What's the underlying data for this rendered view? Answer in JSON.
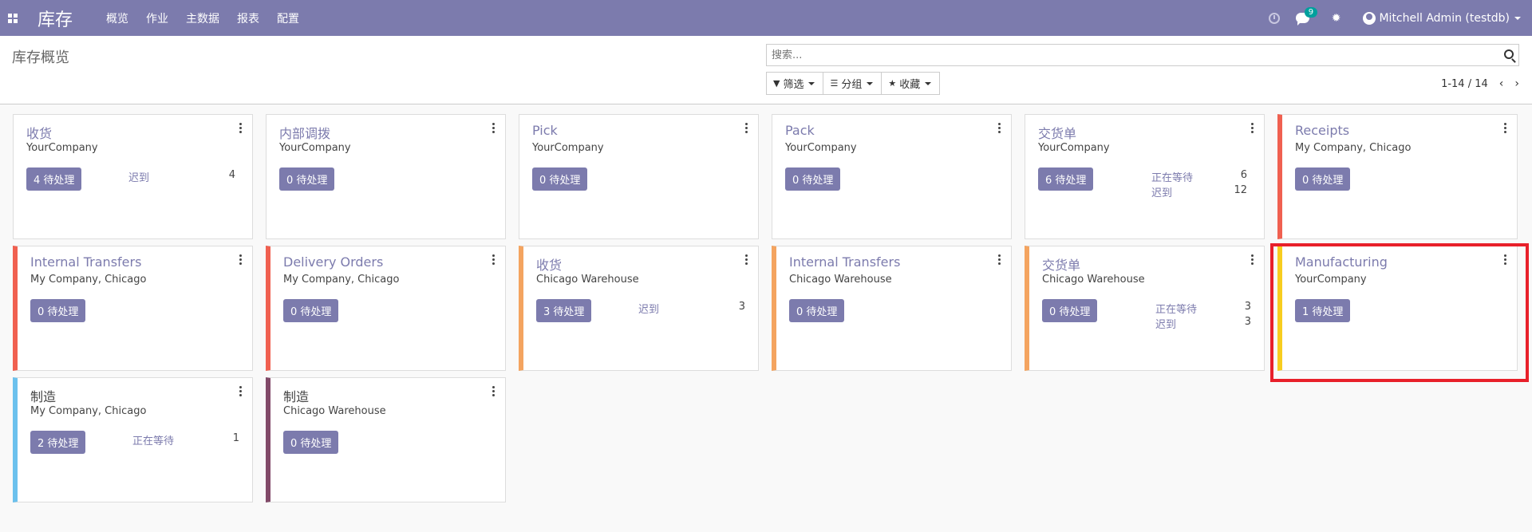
{
  "navbar": {
    "app_name": "库存",
    "menu": [
      "概览",
      "作业",
      "主数据",
      "报表",
      "配置"
    ],
    "chat_count": "9",
    "user": "Mitchell Admin (testdb)",
    "bg_color": "#7c7bad"
  },
  "control_panel": {
    "breadcrumb": "库存概览",
    "search_placeholder": "搜索...",
    "filters": {
      "filter": "筛选",
      "group": "分组",
      "favorites": "收藏"
    },
    "pager": "1-14 / 14"
  },
  "cards": [
    {
      "title": "收货",
      "company": "YourCompany",
      "button": "4 待处理",
      "color": "",
      "stats": [
        {
          "label": "迟到",
          "value": "4"
        }
      ]
    },
    {
      "title": "内部调拨",
      "company": "YourCompany",
      "button": "0 待处理",
      "color": "",
      "stats": []
    },
    {
      "title": "Pick",
      "company": "YourCompany",
      "button": "0 待处理",
      "color": "",
      "stats": []
    },
    {
      "title": "Pack",
      "company": "YourCompany",
      "button": "0 待处理",
      "color": "",
      "stats": []
    },
    {
      "title": "交货单",
      "company": "YourCompany",
      "button": "6 待处理",
      "color": "",
      "stats": [
        {
          "label": "正在等待",
          "value": "6"
        },
        {
          "label": "迟到",
          "value": "12"
        }
      ]
    },
    {
      "title": "Receipts",
      "company": "My Company, Chicago",
      "button": "0 待处理",
      "color": "#f06050",
      "stats": []
    },
    {
      "title": "Internal Transfers",
      "company": "My Company, Chicago",
      "button": "0 待处理",
      "color": "#f06050",
      "stats": []
    },
    {
      "title": "Delivery Orders",
      "company": "My Company, Chicago",
      "button": "0 待处理",
      "color": "#f06050",
      "stats": []
    },
    {
      "title": "收货",
      "company": "Chicago Warehouse",
      "button": "3 待处理",
      "color": "#f4a460",
      "stats": [
        {
          "label": "迟到",
          "value": "3"
        }
      ]
    },
    {
      "title": "Internal Transfers",
      "company": "Chicago Warehouse",
      "button": "0 待处理",
      "color": "#f4a460",
      "stats": []
    },
    {
      "title": "交货单",
      "company": "Chicago Warehouse",
      "button": "0 待处理",
      "color": "#f4a460",
      "stats": [
        {
          "label": "正在等待",
          "value": "3"
        },
        {
          "label": "迟到",
          "value": "3"
        }
      ]
    },
    {
      "title": "Manufacturing",
      "company": "YourCompany",
      "button": "1 待处理",
      "color": "#f7cd1f",
      "stats": []
    },
    {
      "title": "制造",
      "company": "My Company, Chicago",
      "button": "2 待处理",
      "color": "#6cc1ed",
      "stats": [
        {
          "label": "正在等待",
          "value": "1"
        }
      ]
    },
    {
      "title": "制造",
      "company": "Chicago Warehouse",
      "button": "0 待处理",
      "color": "#814968",
      "stats": []
    }
  ]
}
